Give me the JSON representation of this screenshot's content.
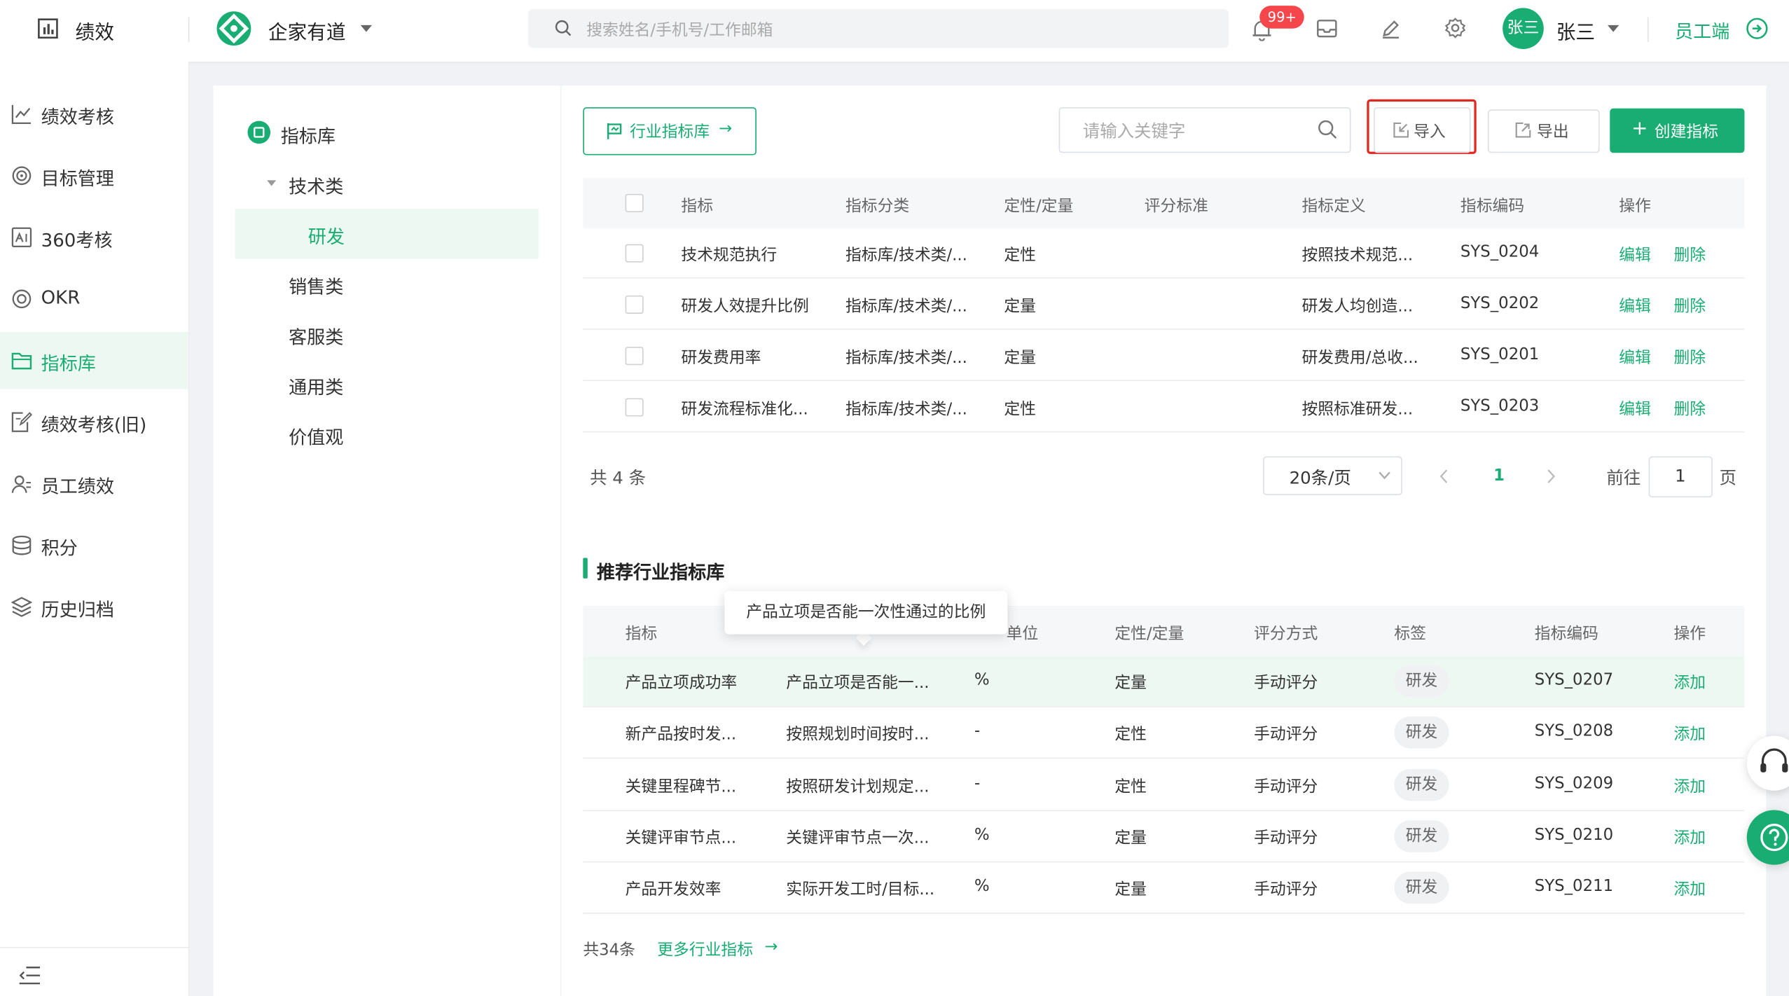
{
  "topbar": {
    "app_name": "绩效",
    "org_name": "企家有道",
    "search_placeholder": "搜索姓名/手机号/工作邮箱",
    "notification_badge": "99+",
    "avatar_text": "张三",
    "user_name": "张三",
    "staff_link": "员工端"
  },
  "sidebar": {
    "items": [
      {
        "label": "绩效考核",
        "icon": "line-chart-icon"
      },
      {
        "label": "目标管理",
        "icon": "target-icon"
      },
      {
        "label": "360考核",
        "icon": "chart-box-icon"
      },
      {
        "label": "OKR",
        "icon": "okr-circle-icon"
      },
      {
        "label": "指标库",
        "icon": "folder-icon",
        "active": true
      },
      {
        "label": "绩效考核(旧)",
        "icon": "edit-doc-icon"
      },
      {
        "label": "员工绩效",
        "icon": "user-icon"
      },
      {
        "label": "积分",
        "icon": "database-icon"
      },
      {
        "label": "历史归档",
        "icon": "layers-icon"
      }
    ]
  },
  "tree": {
    "root": "指标库",
    "group": "技术类",
    "selected": "研发",
    "others": [
      "销售类",
      "客服类",
      "通用类",
      "价值观"
    ]
  },
  "toolbar": {
    "industry_btn": "行业指标库",
    "keyword_placeholder": "请输入关键字",
    "import_btn": "导入",
    "export_btn": "导出",
    "create_btn": "创建指标"
  },
  "table": {
    "headers": [
      "指标",
      "指标分类",
      "定性/定量",
      "评分标准",
      "指标定义",
      "指标编码",
      "操作"
    ],
    "rows": [
      {
        "name": "技术规范执行",
        "category": "指标库/技术类/...",
        "type": "定性",
        "standard": "",
        "definition": "按照技术规范...",
        "code": "SYS_0204",
        "edit": "编辑",
        "delete": "删除"
      },
      {
        "name": "研发人效提升比例",
        "category": "指标库/技术类/...",
        "type": "定量",
        "standard": "",
        "definition": "研发人均创造...",
        "code": "SYS_0202",
        "edit": "编辑",
        "delete": "删除"
      },
      {
        "name": "研发费用率",
        "category": "指标库/技术类/...",
        "type": "定量",
        "standard": "",
        "definition": "研发费用/总收...",
        "code": "SYS_0201",
        "edit": "编辑",
        "delete": "删除"
      },
      {
        "name": "研发流程标准化...",
        "category": "指标库/技术类/...",
        "type": "定性",
        "standard": "",
        "definition": "按照标准研发...",
        "code": "SYS_0203",
        "edit": "编辑",
        "delete": "删除"
      }
    ],
    "total": "共 4 条",
    "page_size": "20条/页",
    "current_page": "1",
    "goto_label": "前往",
    "goto_value": "1",
    "page_suffix": "页"
  },
  "recommend": {
    "title": "推荐行业指标库",
    "headers": [
      "指标",
      "单位",
      "定性/定量",
      "评分方式",
      "标签",
      "指标编码",
      "操作"
    ],
    "tooltip": "产品立项是否能一次性通过的比例",
    "rows": [
      {
        "name": "产品立项成功率",
        "definition": "产品立项是否能一...",
        "unit": "%",
        "type": "定量",
        "method": "手动评分",
        "tag": "研发",
        "code": "SYS_0207",
        "action": "添加"
      },
      {
        "name": "新产品按时发...",
        "definition": "按照规划时间按时...",
        "unit": "-",
        "type": "定性",
        "method": "手动评分",
        "tag": "研发",
        "code": "SYS_0208",
        "action": "添加"
      },
      {
        "name": "关键里程碑节...",
        "definition": "按照研发计划规定...",
        "unit": "-",
        "type": "定性",
        "method": "手动评分",
        "tag": "研发",
        "code": "SYS_0209",
        "action": "添加"
      },
      {
        "name": "关键评审节点...",
        "definition": "关键评审节点一次...",
        "unit": "%",
        "type": "定量",
        "method": "手动评分",
        "tag": "研发",
        "code": "SYS_0210",
        "action": "添加"
      },
      {
        "name": "产品开发效率",
        "definition": "实际开发工时/目标...",
        "unit": "%",
        "type": "定量",
        "method": "手动评分",
        "tag": "研发",
        "code": "SYS_0211",
        "action": "添加"
      }
    ],
    "total": "共34条",
    "more_link": "更多行业指标"
  },
  "colors": {
    "accent": "#1aad73",
    "danger": "#f5474b",
    "highlight": "#e0281e"
  }
}
